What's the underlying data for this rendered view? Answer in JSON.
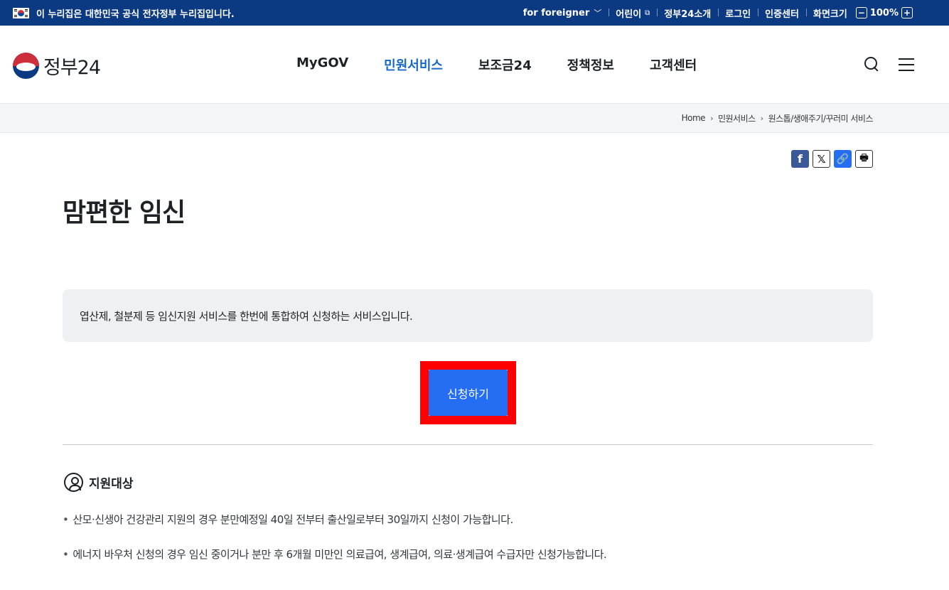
{
  "gov_bar": {
    "notice": "이 누리집은 대한민국 공식 전자정부 누리집입니다.",
    "foreigner": "for foreigner",
    "kids": "어린이",
    "about": "정부24소개",
    "login": "로그인",
    "cert": "인증센터",
    "screen_size": "화면크기",
    "zoom": "100%",
    "zoom_minus": "−",
    "zoom_plus": "+"
  },
  "header": {
    "logo_text": "정부24",
    "nav": [
      "MyGOV",
      "민원서비스",
      "보조금24",
      "정책정보",
      "고객센터"
    ],
    "active_nav": "민원서비스"
  },
  "breadcrumb": [
    "Home",
    "민원서비스",
    "원스톱/생애주기/꾸러미 서비스"
  ],
  "share": {
    "facebook": "f",
    "x": "𝕏",
    "link": "🔗",
    "print": "🖶"
  },
  "page": {
    "title": "맘편한 임신",
    "description": "엽산제, 철분제 등 임신지원 서비스를 한번에 통합하여 신청하는 서비스입니다.",
    "apply_label": "신청하기"
  },
  "eligibility": {
    "heading": "지원대상",
    "items": [
      "산모·신생아 건강관리 지원의 경우 분만예정일 40일 전부터 출산일로부터 30일까지 신청이 가능합니다.",
      "에너지 바우처 신청의 경우 임신 중이거나 분만 후 6개월 미만인 의료급여, 생계급여, 의료·생계급여 수급자만 신청가능합니다."
    ]
  },
  "colors": {
    "gov_bar": "#0b3a82",
    "accent": "#256ef4",
    "active_nav": "#1767c6",
    "highlight": "#ff0000"
  }
}
